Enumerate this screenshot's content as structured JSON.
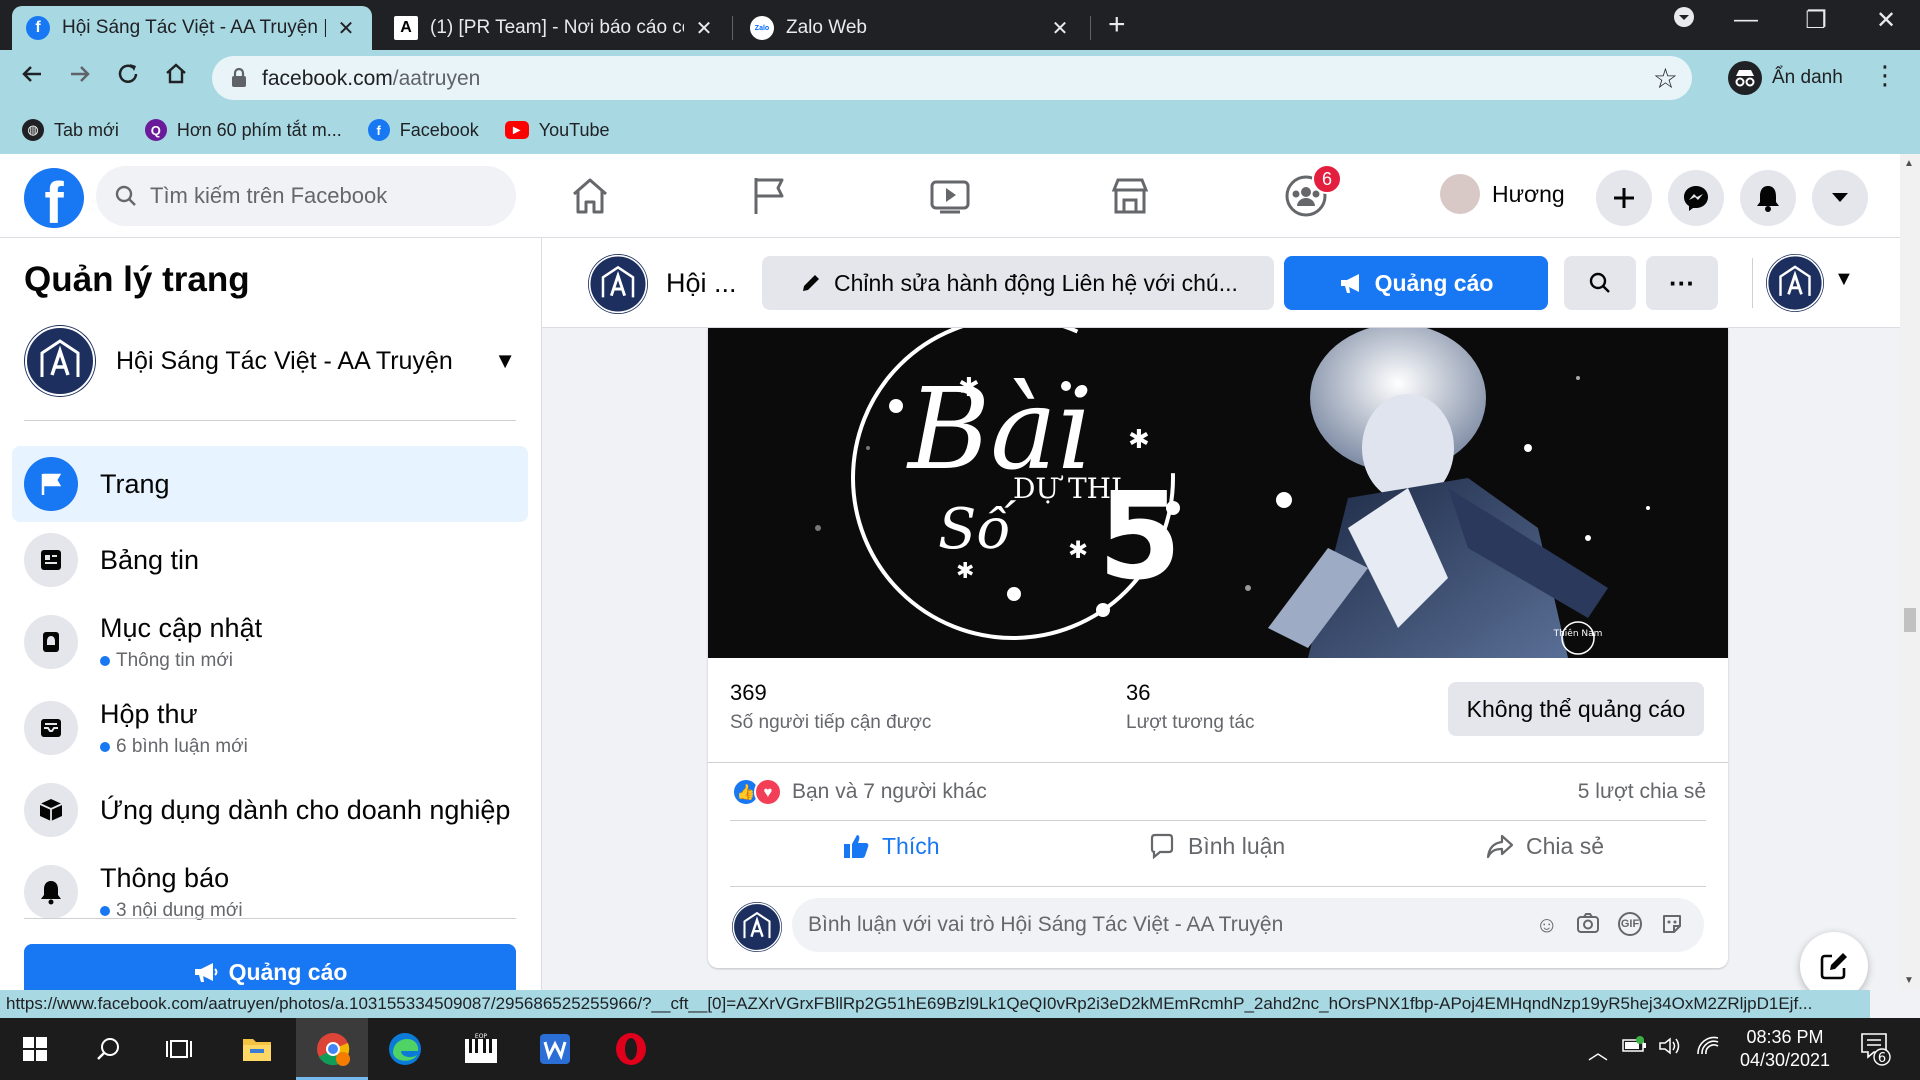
{
  "browser": {
    "tabs": [
      {
        "title": "Hội Sáng Tác Việt - AA Truyện | F",
        "active": true
      },
      {
        "title": "(1) [PR Team] - Nơi báo cáo công",
        "active": false
      },
      {
        "title": "Zalo Web",
        "active": false
      }
    ],
    "zalo_favicon": "Zalo",
    "new_tab_glyph": "+",
    "url_domain": "facebook.com",
    "url_path": "/aatruyen",
    "incognito_label": "Ẩn danh",
    "bookmarks": [
      {
        "label": "Tab mới",
        "icon": "globe-icon"
      },
      {
        "label": "Hơn 60 phím tắt m...",
        "icon": "q-icon"
      },
      {
        "label": "Facebook",
        "icon": "facebook-icon"
      },
      {
        "label": "YouTube",
        "icon": "youtube-icon"
      }
    ]
  },
  "facebook": {
    "logo_letter": "f",
    "search_placeholder": "Tìm kiếm trên Facebook",
    "groups_badge": "6",
    "profile_name": "Hương",
    "colors": {
      "brand": "#1877f2",
      "badge": "#e41e3f"
    }
  },
  "sidebar": {
    "title": "Quản lý trang",
    "page_name": "Hội Sáng Tác Việt - AA Truyện",
    "items": [
      {
        "label": "Trang",
        "sub": "",
        "icon": "flag-icon"
      },
      {
        "label": "Bảng tin",
        "sub": "",
        "icon": "newsfeed-icon"
      },
      {
        "label": "Mục cập nhật",
        "sub": "Thông tin mới",
        "icon": "update-icon"
      },
      {
        "label": "Hộp thư",
        "sub": "6 bình luận mới",
        "icon": "inbox-icon"
      },
      {
        "label": "Ứng dụng dành cho doanh nghiệp",
        "sub": "",
        "icon": "box-icon"
      },
      {
        "label": "Thông báo",
        "sub": "3 nội dung mới",
        "icon": "bell-icon"
      }
    ],
    "ads_button": "Quảng cáo"
  },
  "pagebar": {
    "name": "Hội ...",
    "edit_button": "Chỉnh sửa hành động Liên hệ với chú...",
    "ads_button": "Quảng cáo"
  },
  "post": {
    "banner_text_bai": "Bài",
    "banner_text_duthi": "DỰ THI",
    "banner_text_so": "Số",
    "banner_text_num": "5",
    "artist_sign": "Thiên Nam",
    "reach_value": "369",
    "reach_label": "Số người tiếp cận được",
    "engage_value": "36",
    "engage_label": "Lượt tương tác",
    "no_ads_button": "Không thể quảng cáo",
    "reactions_text": "Bạn và 7 người khác",
    "shares_text": "5 lượt chia sẻ",
    "like_label": "Thích",
    "comment_label": "Bình luận",
    "share_label": "Chia sẻ",
    "comment_placeholder": "Bình luận với vai trò Hội Sáng Tác Việt - AA Truyện",
    "gif_label": "GIF"
  },
  "status_url": "https://www.facebook.com/aatruyen/photos/a.103155334509087/295686525255966/?__cft__[0]=AZXrVGrxFBllRp2G51hE69Bzl9Lk1QeQI0vRp2i3eD2kMEmRcmhP_2ahd2nc_hOrsPNX1fbp-APoj4EMHqndNzp19yR5hej34OxM2ZRljpD1Ejf...",
  "taskbar": {
    "time": "08:36 PM",
    "date": "04/30/2021",
    "notification_count": "6",
    "bluestack_label": "EOP"
  }
}
